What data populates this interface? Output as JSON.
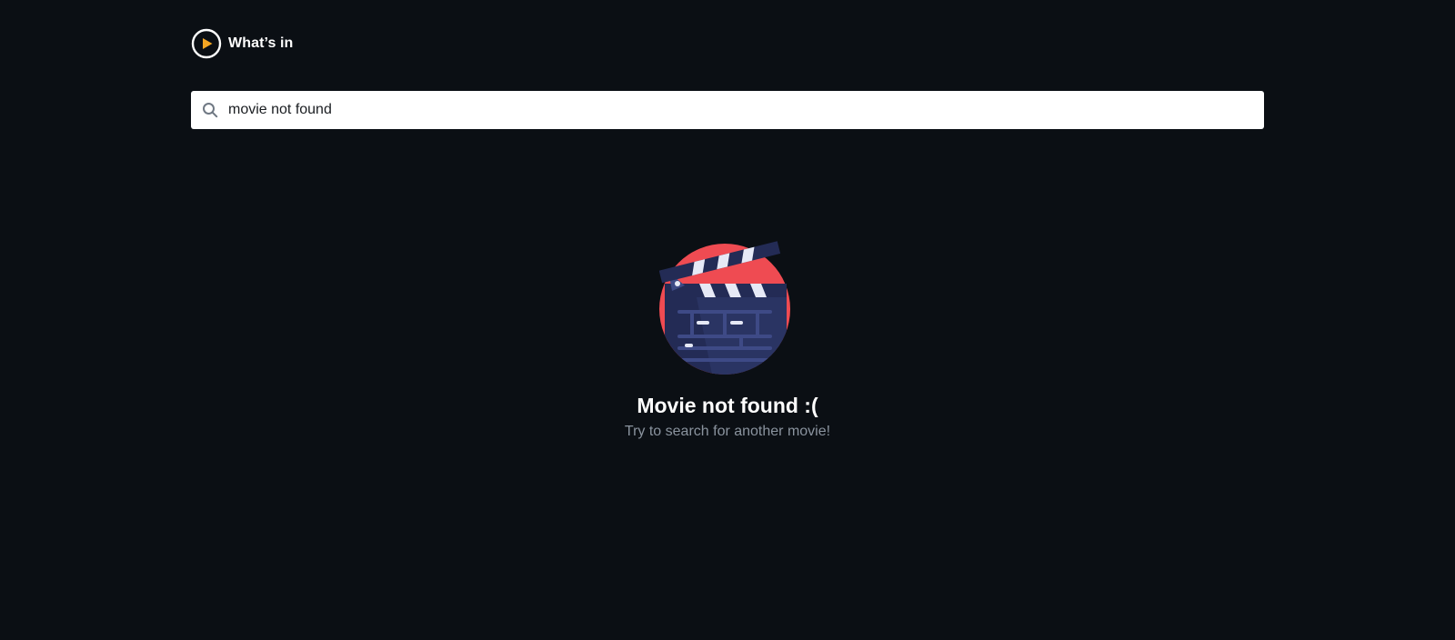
{
  "app": {
    "logo_text": "What’s in",
    "accent_color": "#f5a623"
  },
  "search": {
    "value": "movie not found",
    "placeholder": ""
  },
  "empty_state": {
    "illustration": "clapperboard-icon",
    "title": "Movie not found :(",
    "subtitle": "Try to search for another movie!"
  },
  "colors": {
    "background": "#0b0f14",
    "illustration_red": "#ef4b52",
    "illustration_navy": "#232b55"
  }
}
